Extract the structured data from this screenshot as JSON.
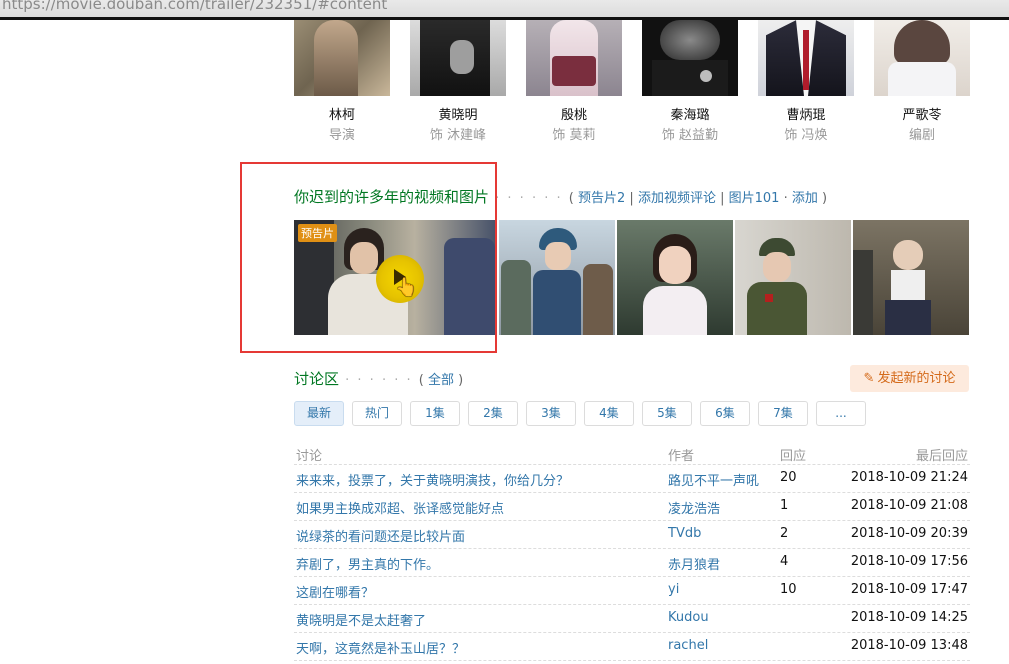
{
  "browser": {
    "url": "https://movie.douban.com/trailer/232351/#content"
  },
  "cast": [
    {
      "name": "林柯",
      "role": "导演",
      "colors": [
        "#7b6f59",
        "#b9a78a"
      ]
    },
    {
      "name": "黄晓明",
      "role": "饰 沐建峰",
      "colors": [
        "#222222",
        "#8a8a8a"
      ]
    },
    {
      "name": "殷桃",
      "role": "饰 莫莉",
      "colors": [
        "#d9cfd3",
        "#7c5a63"
      ]
    },
    {
      "name": "秦海璐",
      "role": "饰 赵益勤",
      "colors": [
        "#151515",
        "#6c6c6c"
      ]
    },
    {
      "name": "曹炳琨",
      "role": "饰 冯焕",
      "colors": [
        "#d8d8e0",
        "#202030"
      ]
    },
    {
      "name": "严歌苓",
      "role": "编剧",
      "colors": [
        "#e9e4e0",
        "#5e4a45"
      ]
    }
  ],
  "media": {
    "title": "你迟到的许多年的视频和图片",
    "dots": "· · · · · ·",
    "open": "(",
    "trailers": "预告片2",
    "sep": "|",
    "add_video_review": "添加视频评论",
    "photos": "图片101",
    "middot": "·",
    "add": "添加",
    "close": ")",
    "trailer_badge": "预告片",
    "cursor": "👆"
  },
  "discussion": {
    "title": "讨论区",
    "dots": "· · · · · ·",
    "all_open": "(",
    "all": "全部",
    "all_close": ")",
    "new_button": "发起新的讨论",
    "pen": "✎",
    "tabs": [
      "最新",
      "热门",
      "1集",
      "2集",
      "3集",
      "4集",
      "5集",
      "6集",
      "7集",
      "..."
    ],
    "headers": {
      "topic": "讨论",
      "author": "作者",
      "replies": "回应",
      "last": "最后回应"
    },
    "rows": [
      {
        "topic": "来来来，投票了，关于黄晓明演技，你给几分？",
        "author": "路见不平一声吼",
        "replies": "20",
        "last": "2018-10-09 21:24"
      },
      {
        "topic": "如果男主换成邓超、张译感觉能好点",
        "author": "凌龙浩浩",
        "replies": "1",
        "last": "2018-10-09 21:08"
      },
      {
        "topic": "说绿茶的看问题还是比较片面",
        "author": "TVdb",
        "replies": "2",
        "last": "2018-10-09 20:39"
      },
      {
        "topic": "弃剧了，男主真的下作。",
        "author": "赤月狼君",
        "replies": "4",
        "last": "2018-10-09 17:56"
      },
      {
        "topic": "这剧在哪看？",
        "author": "yi",
        "replies": "10",
        "last": "2018-10-09 17:47"
      },
      {
        "topic": "黄晓明是不是太赶奢了",
        "author": "Kudou",
        "replies": "",
        "last": "2018-10-09 14:25"
      },
      {
        "topic": "天啊，这竟然是补玉山居？？",
        "author": "rachel",
        "replies": "",
        "last": "2018-10-09 13:48"
      }
    ]
  }
}
